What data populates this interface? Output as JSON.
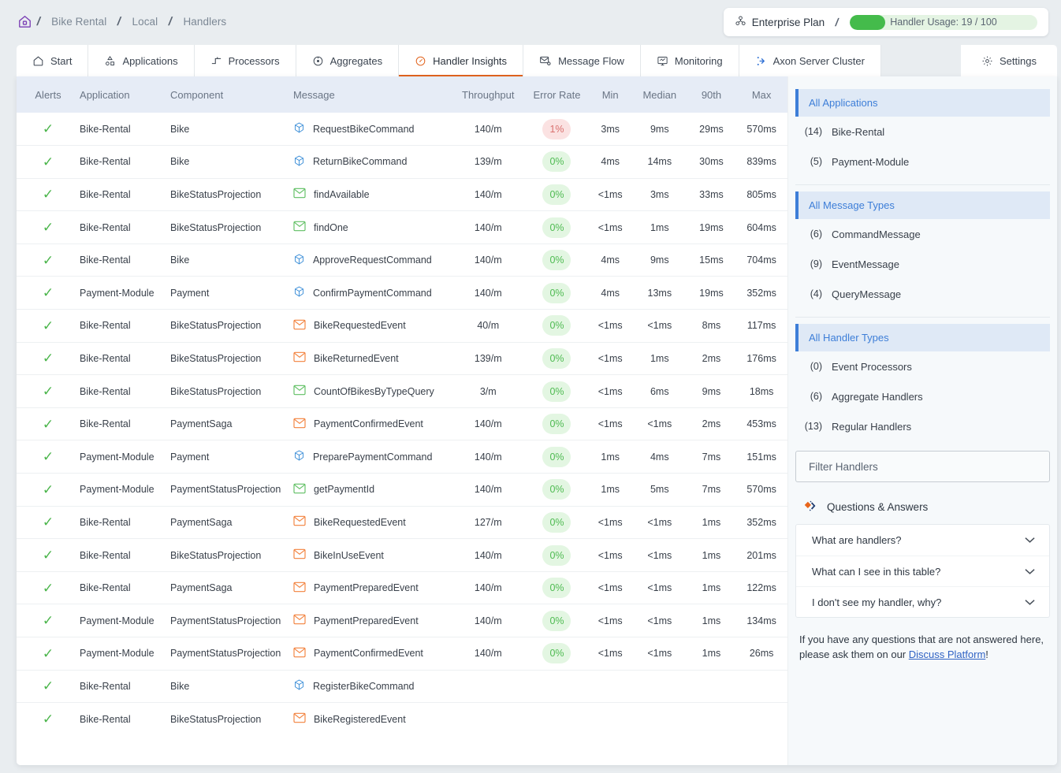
{
  "breadcrumb": {
    "home_icon": "home-icon",
    "items": [
      "Bike Rental",
      "Local",
      "Handlers"
    ]
  },
  "plan": {
    "icon": "plan-cluster-icon",
    "name": "Enterprise Plan",
    "separator": "/",
    "usage_label": "Handler Usage: 19 / 100",
    "usage_used": 19,
    "usage_total": 100,
    "fill_color": "#44bb4b",
    "track_color": "#e4f4e3"
  },
  "tabs": [
    {
      "label": "Start",
      "icon": "home-icon",
      "active": false
    },
    {
      "label": "Applications",
      "icon": "applications-icon",
      "active": false
    },
    {
      "label": "Processors",
      "icon": "processors-icon",
      "active": false
    },
    {
      "label": "Aggregates",
      "icon": "aggregates-icon",
      "active": false
    },
    {
      "label": "Handler Insights",
      "icon": "gauge-icon",
      "active": true
    },
    {
      "label": "Message Flow",
      "icon": "message-flow-icon",
      "active": false
    },
    {
      "label": "Monitoring",
      "icon": "monitoring-icon",
      "active": false
    },
    {
      "label": "Axon Server Cluster",
      "icon": "axon-cluster-icon",
      "active": false
    }
  ],
  "settings_tab": {
    "label": "Settings",
    "icon": "gear-icon"
  },
  "table": {
    "columns": [
      "Alerts",
      "Application",
      "Component",
      "Message",
      "Throughput",
      "Error Rate",
      "Min",
      "Median",
      "90th",
      "Max"
    ],
    "rows": [
      {
        "alert": "ok",
        "application": "Bike-Rental",
        "component": "Bike",
        "message": "RequestBikeCommand",
        "msg_icon": "command-cube-icon",
        "throughput": "140/m",
        "error_rate": "1%",
        "error_state": "warn",
        "min": "3ms",
        "median": "9ms",
        "p90": "29ms",
        "max": "570ms"
      },
      {
        "alert": "ok",
        "application": "Bike-Rental",
        "component": "Bike",
        "message": "ReturnBikeCommand",
        "msg_icon": "command-cube-icon",
        "throughput": "139/m",
        "error_rate": "0%",
        "error_state": "ok",
        "min": "4ms",
        "median": "14ms",
        "p90": "30ms",
        "max": "839ms"
      },
      {
        "alert": "ok",
        "application": "Bike-Rental",
        "component": "BikeStatusProjection",
        "message": "findAvailable",
        "msg_icon": "query-envelope-icon",
        "throughput": "140/m",
        "error_rate": "0%",
        "error_state": "ok",
        "min": "<1ms",
        "median": "3ms",
        "p90": "33ms",
        "max": "805ms"
      },
      {
        "alert": "ok",
        "application": "Bike-Rental",
        "component": "BikeStatusProjection",
        "message": "findOne",
        "msg_icon": "query-envelope-icon",
        "throughput": "140/m",
        "error_rate": "0%",
        "error_state": "ok",
        "min": "<1ms",
        "median": "1ms",
        "p90": "19ms",
        "max": "604ms"
      },
      {
        "alert": "ok",
        "application": "Bike-Rental",
        "component": "Bike",
        "message": "ApproveRequestCommand",
        "msg_icon": "command-cube-icon",
        "throughput": "140/m",
        "error_rate": "0%",
        "error_state": "ok",
        "min": "4ms",
        "median": "9ms",
        "p90": "15ms",
        "max": "704ms"
      },
      {
        "alert": "ok",
        "application": "Payment-Module",
        "component": "Payment",
        "message": "ConfirmPaymentCommand",
        "msg_icon": "command-cube-icon",
        "throughput": "140/m",
        "error_rate": "0%",
        "error_state": "ok",
        "min": "4ms",
        "median": "13ms",
        "p90": "19ms",
        "max": "352ms"
      },
      {
        "alert": "ok",
        "application": "Bike-Rental",
        "component": "BikeStatusProjection",
        "message": "BikeRequestedEvent",
        "msg_icon": "event-envelope-icon",
        "throughput": "40/m",
        "error_rate": "0%",
        "error_state": "ok",
        "min": "<1ms",
        "median": "<1ms",
        "p90": "8ms",
        "max": "117ms"
      },
      {
        "alert": "ok",
        "application": "Bike-Rental",
        "component": "BikeStatusProjection",
        "message": "BikeReturnedEvent",
        "msg_icon": "event-envelope-icon",
        "throughput": "139/m",
        "error_rate": "0%",
        "error_state": "ok",
        "min": "<1ms",
        "median": "1ms",
        "p90": "2ms",
        "max": "176ms"
      },
      {
        "alert": "ok",
        "application": "Bike-Rental",
        "component": "BikeStatusProjection",
        "message": "CountOfBikesByTypeQuery",
        "msg_icon": "query-envelope-icon",
        "throughput": "3/m",
        "error_rate": "0%",
        "error_state": "ok",
        "min": "<1ms",
        "median": "6ms",
        "p90": "9ms",
        "max": "18ms"
      },
      {
        "alert": "ok",
        "application": "Bike-Rental",
        "component": "PaymentSaga",
        "message": "PaymentConfirmedEvent",
        "msg_icon": "event-envelope-icon",
        "throughput": "140/m",
        "error_rate": "0%",
        "error_state": "ok",
        "min": "<1ms",
        "median": "<1ms",
        "p90": "2ms",
        "max": "453ms"
      },
      {
        "alert": "ok",
        "application": "Payment-Module",
        "component": "Payment",
        "message": "PreparePaymentCommand",
        "msg_icon": "command-cube-icon",
        "throughput": "140/m",
        "error_rate": "0%",
        "error_state": "ok",
        "min": "1ms",
        "median": "4ms",
        "p90": "7ms",
        "max": "151ms"
      },
      {
        "alert": "ok",
        "application": "Payment-Module",
        "component": "PaymentStatusProjection",
        "message": "getPaymentId",
        "msg_icon": "query-envelope-icon",
        "throughput": "140/m",
        "error_rate": "0%",
        "error_state": "ok",
        "min": "1ms",
        "median": "5ms",
        "p90": "7ms",
        "max": "570ms"
      },
      {
        "alert": "ok",
        "application": "Bike-Rental",
        "component": "PaymentSaga",
        "message": "BikeRequestedEvent",
        "msg_icon": "event-envelope-icon",
        "throughput": "127/m",
        "error_rate": "0%",
        "error_state": "ok",
        "min": "<1ms",
        "median": "<1ms",
        "p90": "1ms",
        "max": "352ms"
      },
      {
        "alert": "ok",
        "application": "Bike-Rental",
        "component": "BikeStatusProjection",
        "message": "BikeInUseEvent",
        "msg_icon": "event-envelope-icon",
        "throughput": "140/m",
        "error_rate": "0%",
        "error_state": "ok",
        "min": "<1ms",
        "median": "<1ms",
        "p90": "1ms",
        "max": "201ms"
      },
      {
        "alert": "ok",
        "application": "Bike-Rental",
        "component": "PaymentSaga",
        "message": "PaymentPreparedEvent",
        "msg_icon": "event-envelope-icon",
        "throughput": "140/m",
        "error_rate": "0%",
        "error_state": "ok",
        "min": "<1ms",
        "median": "<1ms",
        "p90": "1ms",
        "max": "122ms"
      },
      {
        "alert": "ok",
        "application": "Payment-Module",
        "component": "PaymentStatusProjection",
        "message": "PaymentPreparedEvent",
        "msg_icon": "event-envelope-icon",
        "throughput": "140/m",
        "error_rate": "0%",
        "error_state": "ok",
        "min": "<1ms",
        "median": "<1ms",
        "p90": "1ms",
        "max": "134ms"
      },
      {
        "alert": "ok",
        "application": "Payment-Module",
        "component": "PaymentStatusProjection",
        "message": "PaymentConfirmedEvent",
        "msg_icon": "event-envelope-icon",
        "throughput": "140/m",
        "error_rate": "0%",
        "error_state": "ok",
        "min": "<1ms",
        "median": "<1ms",
        "p90": "1ms",
        "max": "26ms"
      },
      {
        "alert": "ok",
        "application": "Bike-Rental",
        "component": "Bike",
        "message": "RegisterBikeCommand",
        "msg_icon": "command-cube-icon",
        "throughput": "",
        "error_rate": "",
        "error_state": "none",
        "min": "",
        "median": "",
        "p90": "",
        "max": ""
      },
      {
        "alert": "ok",
        "application": "Bike-Rental",
        "component": "BikeStatusProjection",
        "message": "BikeRegisteredEvent",
        "msg_icon": "event-envelope-icon",
        "throughput": "",
        "error_rate": "",
        "error_state": "none",
        "min": "",
        "median": "",
        "p90": "",
        "max": ""
      }
    ]
  },
  "sidebar": {
    "sections": [
      {
        "title": "All Applications",
        "items": [
          {
            "count": "(14)",
            "label": "Bike-Rental"
          },
          {
            "count": "(5)",
            "label": "Payment-Module"
          }
        ]
      },
      {
        "title": "All Message Types",
        "items": [
          {
            "count": "(6)",
            "label": "CommandMessage"
          },
          {
            "count": "(9)",
            "label": "EventMessage"
          },
          {
            "count": "(4)",
            "label": "QueryMessage"
          }
        ]
      },
      {
        "title": "All Handler Types",
        "items": [
          {
            "count": "(0)",
            "label": "Event Processors"
          },
          {
            "count": "(6)",
            "label": "Aggregate Handlers"
          },
          {
            "count": "(13)",
            "label": "Regular Handlers"
          }
        ]
      }
    ],
    "filter": {
      "placeholder": "Filter Handlers",
      "value": ""
    },
    "qa": {
      "icon": "axon-diamond-icon",
      "title": "Questions & Answers",
      "questions": [
        {
          "label": "What are handlers?",
          "chevron": "chevron-down-icon"
        },
        {
          "label": "What can I see in this table?",
          "chevron": "chevron-down-icon"
        },
        {
          "label": "I don't see my handler, why?",
          "chevron": "chevron-down-icon"
        }
      ],
      "footer_before": "If you have any questions that are not answered here, please ask them on our ",
      "footer_link": "Discuss Platform",
      "footer_after": "!"
    }
  },
  "colors": {
    "accent_orange": "#e2641e",
    "link_blue": "#2f62c4",
    "section_blue": "#3d7ed8",
    "ok_green": "#4fbb52",
    "warn_red": "#d9706e",
    "command_blue": "#3d8fd8",
    "event_orange": "#f2813c",
    "query_green": "#5fbf62"
  }
}
